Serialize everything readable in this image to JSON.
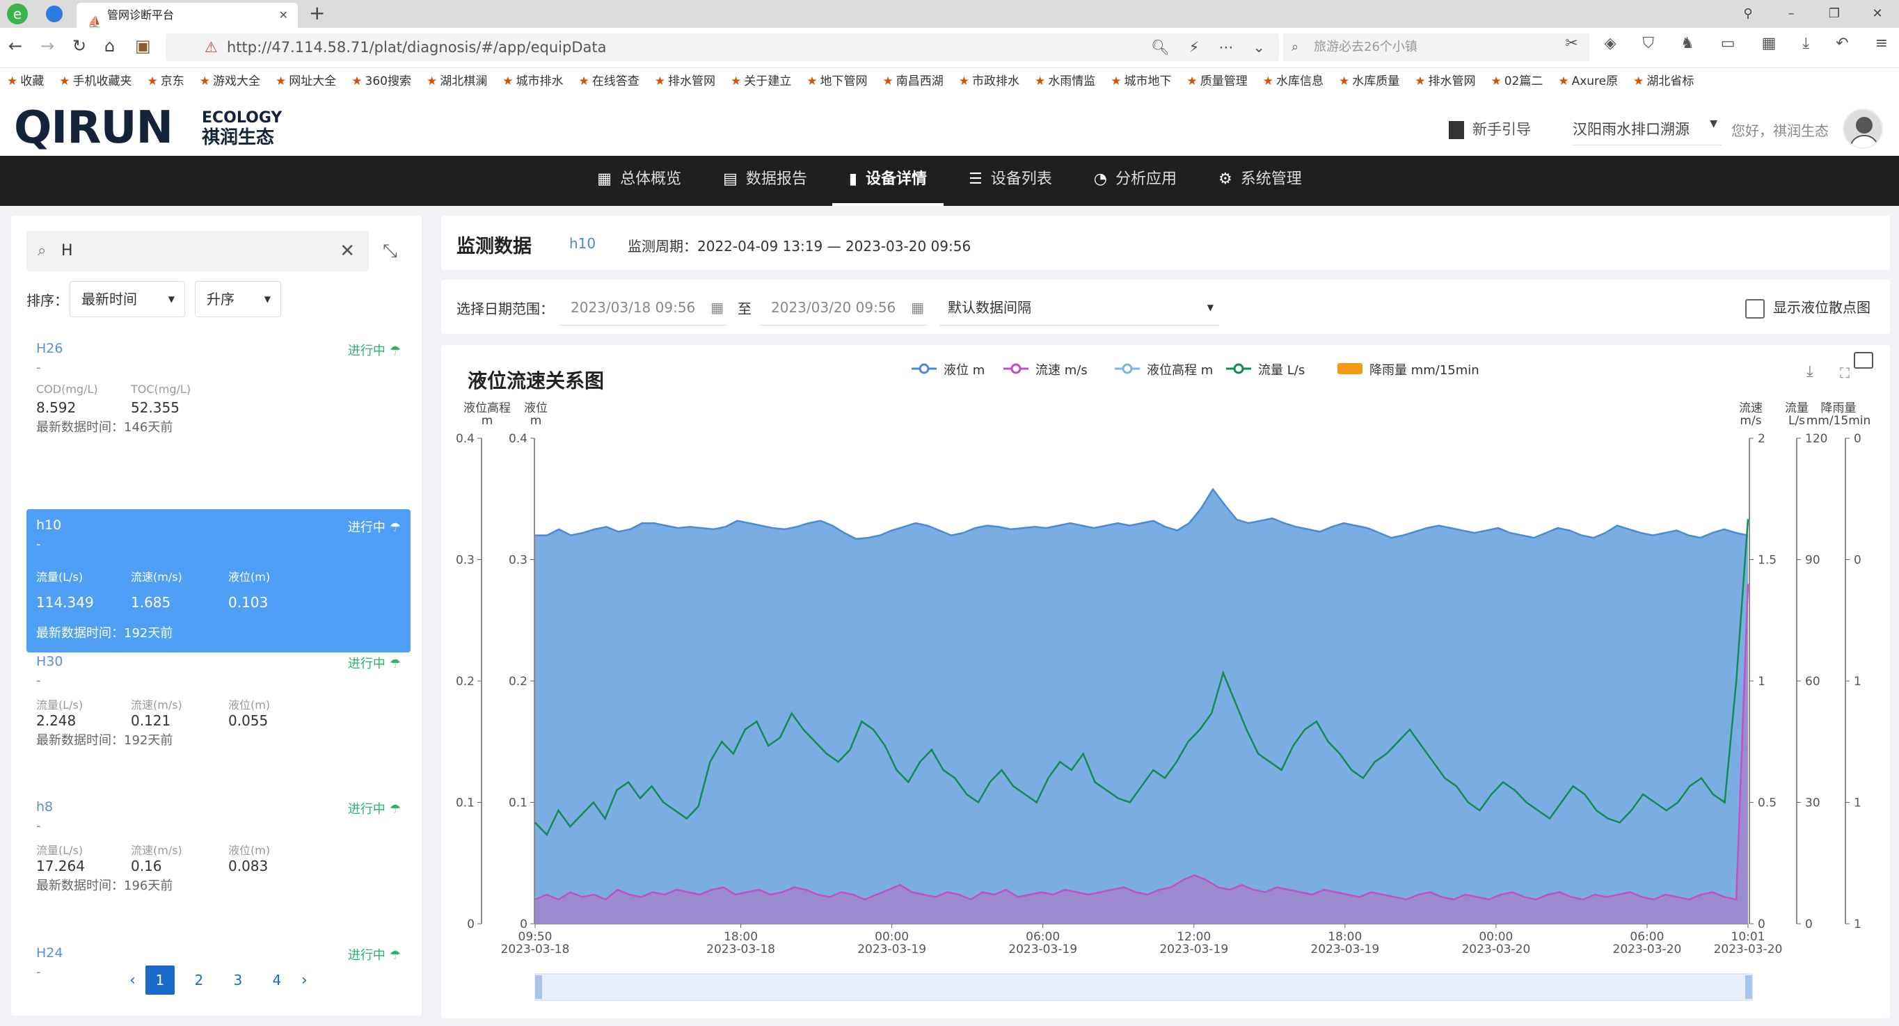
{
  "browser": {
    "tab_title": "管网诊断平台",
    "url": "http://47.114.58.71/plat/diagnosis/#/app/equipData",
    "search_placeholder": "旅游必去26个小镇",
    "bookmarks": [
      "收藏",
      "手机收藏夹",
      "京东",
      "游戏大全",
      "网址大全",
      "360搜索",
      "湖北棋澜",
      "城市排水",
      "在线答查",
      "排水管网",
      "关于建立",
      "地下管网",
      "南昌西湖",
      "市政排水",
      "水雨情监",
      "城市地下",
      "质量管理",
      "水库信息",
      "水库质量",
      "排水管网",
      "02篇二",
      "Axure原",
      "湖北省标"
    ]
  },
  "header": {
    "brand_main": "QIRUN",
    "brand_en": "ECOLOGY",
    "brand_cn": "祺润生态",
    "guide": "新手引导",
    "site": "汉阳雨水排口溯源",
    "greeting": "您好，祺润生态"
  },
  "nav": [
    {
      "label": "总体概览",
      "icon": "grid-icon"
    },
    {
      "label": "数据报告",
      "icon": "report-icon"
    },
    {
      "label": "设备详情",
      "icon": "bar-chart-icon",
      "active": true
    },
    {
      "label": "设备列表",
      "icon": "list-icon"
    },
    {
      "label": "分析应用",
      "icon": "pie-icon"
    },
    {
      "label": "系统管理",
      "icon": "gear-icon"
    }
  ],
  "sidebar": {
    "search_value": "H",
    "sort_label": "排序：",
    "sort_field": "最新时间",
    "sort_order": "升序",
    "devices": [
      {
        "name": "H26",
        "status": "进行中",
        "dash": "-",
        "f1_label": "COD(mg/L)",
        "f1_value": "8.592",
        "f2_label": "TOC(mg/L)",
        "f2_value": "52.355",
        "time": "最新数据时间：146天前"
      },
      {
        "name": "h10",
        "status": "进行中",
        "dash": "-",
        "f1_label": "流量(L/s)",
        "f1_value": "114.349",
        "f2_label": "流速(m/s)",
        "f2_value": "1.685",
        "f3_label": "液位(m)",
        "f3_value": "0.103",
        "time": "最新数据时间：192天前",
        "active": true
      },
      {
        "name": "H30",
        "status": "进行中",
        "dash": "-",
        "f1_label": "流量(L/s)",
        "f1_value": "2.248",
        "f2_label": "流速(m/s)",
        "f2_value": "0.121",
        "f3_label": "液位(m)",
        "f3_value": "0.055",
        "time": "最新数据时间：192天前"
      },
      {
        "name": "h8",
        "status": "进行中",
        "dash": "-",
        "f1_label": "流量(L/s)",
        "f1_value": "17.264",
        "f2_label": "流速(m/s)",
        "f2_value": "0.16",
        "f3_label": "液位(m)",
        "f3_value": "0.083",
        "time": "最新数据时间：196天前"
      },
      {
        "name": "H24",
        "status": "进行中",
        "dash": "-"
      }
    ],
    "pages": [
      "1",
      "2",
      "3",
      "4"
    ],
    "current_page": "1"
  },
  "monitor": {
    "title": "监测数据",
    "device": "h10",
    "period": "监测周期：2022-04-09 13:19 — 2023-03-20 09:56"
  },
  "filter": {
    "label": "选择日期范围：",
    "start": "2023/03/18 09:56",
    "to": "至",
    "end": "2023/03/20 09:56",
    "interval": "默认数据间隔",
    "scatter_label": "显示液位散点图"
  },
  "chart_data": {
    "type": "area",
    "title": "液位流速关系图",
    "legend": [
      {
        "name": "液位 m",
        "color": "#4a8bd6"
      },
      {
        "name": "流速 m/s",
        "color": "#c24fc7"
      },
      {
        "name": "液位高程 m",
        "color": "#7fb3e8"
      },
      {
        "name": "流量 L/s",
        "color": "#138a4f"
      },
      {
        "name": "降雨量 mm/15min",
        "color": "#f59a14"
      }
    ],
    "axes": {
      "left_outer": {
        "label_line1": "液位高程",
        "label_line2": "m",
        "range": [
          0,
          0.4
        ],
        "ticks": [
          "0",
          "0.1",
          "0.2",
          "0.3",
          "0.4"
        ]
      },
      "left_inner": {
        "label_line1": "液位",
        "label_line2": "m",
        "range": [
          0,
          0.4
        ],
        "ticks": [
          "0",
          "0.1",
          "0.2",
          "0.3",
          "0.4"
        ]
      },
      "right_speed": {
        "label_line1": "流速",
        "label_line2": "m/s",
        "range": [
          0,
          2
        ],
        "ticks": [
          "0",
          "0.5",
          "1",
          "1.5",
          "2"
        ]
      },
      "right_flow": {
        "label_line1": "流量",
        "label_line2": "L/s",
        "range": [
          0,
          120
        ],
        "ticks": [
          "0",
          "30",
          "60",
          "90",
          "120"
        ]
      },
      "right_rain": {
        "label_line1": "降雨量",
        "label_line2": "mm/15min",
        "inverted": true,
        "ticks": [
          "1",
          "1",
          "1",
          "0",
          "0"
        ]
      }
    },
    "x_ticks": [
      {
        "t": "09:50",
        "d": "2023-03-18"
      },
      {
        "t": "18:00",
        "d": "2023-03-18"
      },
      {
        "t": "00:00",
        "d": "2023-03-19"
      },
      {
        "t": "06:00",
        "d": "2023-03-19"
      },
      {
        "t": "12:00",
        "d": "2023-03-19"
      },
      {
        "t": "18:00",
        "d": "2023-03-19"
      },
      {
        "t": "00:00",
        "d": "2023-03-20"
      },
      {
        "t": "06:00",
        "d": "2023-03-20"
      },
      {
        "t": "10:01",
        "d": "2023-03-20"
      }
    ],
    "x_hours": [
      0,
      8.17,
      14.17,
      20.17,
      26.17,
      32.17,
      38.17,
      44.17,
      48.18
    ],
    "level_m": [
      0.32,
      0.32,
      0.325,
      0.32,
      0.322,
      0.325,
      0.327,
      0.323,
      0.325,
      0.33,
      0.33,
      0.328,
      0.326,
      0.327,
      0.326,
      0.325,
      0.327,
      0.332,
      0.33,
      0.328,
      0.326,
      0.325,
      0.327,
      0.33,
      0.332,
      0.328,
      0.322,
      0.317,
      0.318,
      0.32,
      0.324,
      0.327,
      0.33,
      0.328,
      0.324,
      0.32,
      0.322,
      0.326,
      0.328,
      0.327,
      0.325,
      0.326,
      0.327,
      0.326,
      0.328,
      0.33,
      0.328,
      0.326,
      0.328,
      0.33,
      0.328,
      0.33,
      0.332,
      0.327,
      0.324,
      0.33,
      0.342,
      0.358,
      0.345,
      0.333,
      0.33,
      0.332,
      0.334,
      0.33,
      0.327,
      0.325,
      0.323,
      0.327,
      0.33,
      0.328,
      0.326,
      0.322,
      0.318,
      0.32,
      0.323,
      0.326,
      0.328,
      0.326,
      0.324,
      0.322,
      0.324,
      0.326,
      0.322,
      0.32,
      0.318,
      0.322,
      0.326,
      0.324,
      0.32,
      0.318,
      0.322,
      0.328,
      0.325,
      0.322,
      0.32,
      0.322,
      0.324,
      0.32,
      0.318,
      0.322,
      0.325,
      0.322,
      0.32
    ],
    "speed_ms": [
      0.1,
      0.12,
      0.1,
      0.13,
      0.11,
      0.12,
      0.1,
      0.14,
      0.12,
      0.11,
      0.13,
      0.12,
      0.14,
      0.13,
      0.12,
      0.14,
      0.15,
      0.12,
      0.13,
      0.14,
      0.12,
      0.13,
      0.15,
      0.14,
      0.12,
      0.11,
      0.13,
      0.12,
      0.1,
      0.12,
      0.14,
      0.16,
      0.13,
      0.12,
      0.11,
      0.13,
      0.12,
      0.1,
      0.13,
      0.12,
      0.14,
      0.11,
      0.12,
      0.13,
      0.12,
      0.14,
      0.13,
      0.12,
      0.13,
      0.14,
      0.15,
      0.13,
      0.12,
      0.14,
      0.15,
      0.18,
      0.2,
      0.18,
      0.15,
      0.14,
      0.16,
      0.14,
      0.13,
      0.15,
      0.14,
      0.13,
      0.12,
      0.14,
      0.13,
      0.12,
      0.11,
      0.13,
      0.12,
      0.11,
      0.1,
      0.12,
      0.13,
      0.11,
      0.1,
      0.12,
      0.11,
      0.1,
      0.12,
      0.13,
      0.11,
      0.1,
      0.12,
      0.13,
      0.11,
      0.1,
      0.12,
      0.11,
      0.12,
      0.13,
      0.11,
      0.1,
      0.12,
      0.11,
      0.1,
      0.12,
      0.13,
      0.11,
      0.1,
      1.4
    ],
    "flow_ls": [
      25,
      22,
      28,
      24,
      27,
      30,
      26,
      33,
      35,
      31,
      34,
      30,
      28,
      26,
      29,
      40,
      45,
      42,
      48,
      50,
      44,
      46,
      52,
      48,
      45,
      42,
      40,
      43,
      50,
      48,
      44,
      38,
      35,
      40,
      43,
      38,
      36,
      32,
      30,
      35,
      38,
      34,
      32,
      30,
      36,
      40,
      38,
      42,
      35,
      33,
      31,
      30,
      34,
      38,
      36,
      40,
      45,
      48,
      52,
      62,
      55,
      48,
      42,
      40,
      38,
      44,
      48,
      50,
      45,
      42,
      38,
      36,
      40,
      42,
      45,
      48,
      44,
      40,
      36,
      34,
      30,
      28,
      32,
      35,
      33,
      30,
      28,
      26,
      30,
      34,
      32,
      28,
      26,
      25,
      28,
      32,
      30,
      28,
      30,
      34,
      36,
      32,
      30,
      60,
      100
    ]
  },
  "toolbox": {
    "download": "download-icon",
    "fullscreen": "fullscreen-icon",
    "table": "table-icon"
  }
}
